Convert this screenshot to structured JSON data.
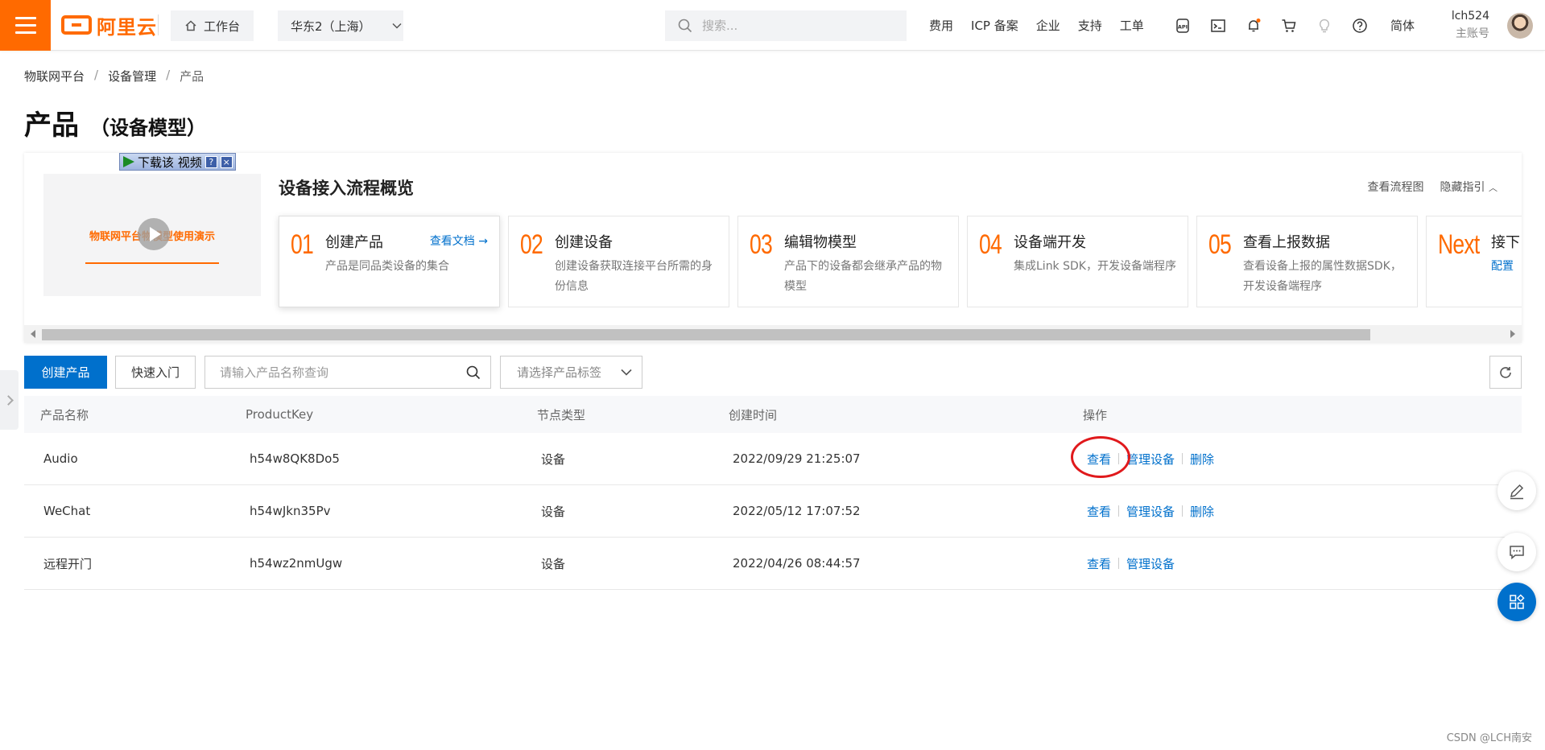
{
  "header": {
    "logo_text": "阿里云",
    "workbench_label": "工作台",
    "region_label": "华东2（上海）",
    "search_placeholder": "搜索...",
    "nav_links": [
      "费用",
      "ICP 备案",
      "企业",
      "支持",
      "工单"
    ],
    "icons": [
      "api-icon",
      "terminal-icon",
      "bell-icon",
      "cart-icon",
      "bulb-icon",
      "help-icon"
    ],
    "lang": "简体",
    "user_name": "lch524",
    "user_role": "主账号",
    "accent_color": "#ff6a00"
  },
  "breadcrumb": [
    "物联网平台",
    "设备管理",
    "产品"
  ],
  "page": {
    "title": "产品",
    "subtitle": "（设备模型）"
  },
  "guide": {
    "video_text": "物联网平台物模型使用演示",
    "download_bar": "下载该 视频",
    "title": "设备接入流程概览",
    "link_flow": "查看流程图",
    "link_hide": "隐藏指引",
    "steps": [
      {
        "num": "01",
        "title": "创建产品",
        "desc": "产品是同品类设备的集合",
        "doc": "查看文档"
      },
      {
        "num": "02",
        "title": "创建设备",
        "desc": "创建设备获取连接平台所需的身份信息"
      },
      {
        "num": "03",
        "title": "编辑物模型",
        "desc": "产品下的设备都会继承产品的物模型"
      },
      {
        "num": "04",
        "title": "设备端开发",
        "desc": "集成Link SDK，开发设备端程序"
      },
      {
        "num": "05",
        "title": "查看上报数据",
        "desc": "查看设备上报的属性数据SDK，开发设备端程序"
      },
      {
        "num": "Next",
        "title": "接下",
        "desc": "配置"
      }
    ]
  },
  "toolbar": {
    "create_label": "创建产品",
    "quick_start_label": "快速入门",
    "search_placeholder": "请输入产品名称查询",
    "tag_placeholder": "请选择产品标签"
  },
  "table": {
    "columns": [
      "产品名称",
      "ProductKey",
      "节点类型",
      "创建时间",
      "操作"
    ],
    "rows": [
      {
        "name": "Audio",
        "key": "h54w8QK8Do5",
        "type": "设备",
        "created": "2022/09/29 21:25:07",
        "actions": [
          "查看",
          "管理设备",
          "删除"
        ]
      },
      {
        "name": "WeChat",
        "key": "h54wJkn35Pv",
        "type": "设备",
        "created": "2022/05/12 17:07:52",
        "actions": [
          "查看",
          "管理设备",
          "删除"
        ]
      },
      {
        "name": "远程开门",
        "key": "h54wz2nmUgw",
        "type": "设备",
        "created": "2022/04/26 08:44:57",
        "actions": [
          "查看",
          "管理设备"
        ]
      }
    ]
  },
  "watermark": "CSDN @LCH南安",
  "colors": {
    "primary": "#0070cc",
    "highlight_ring": "#e0191c"
  }
}
